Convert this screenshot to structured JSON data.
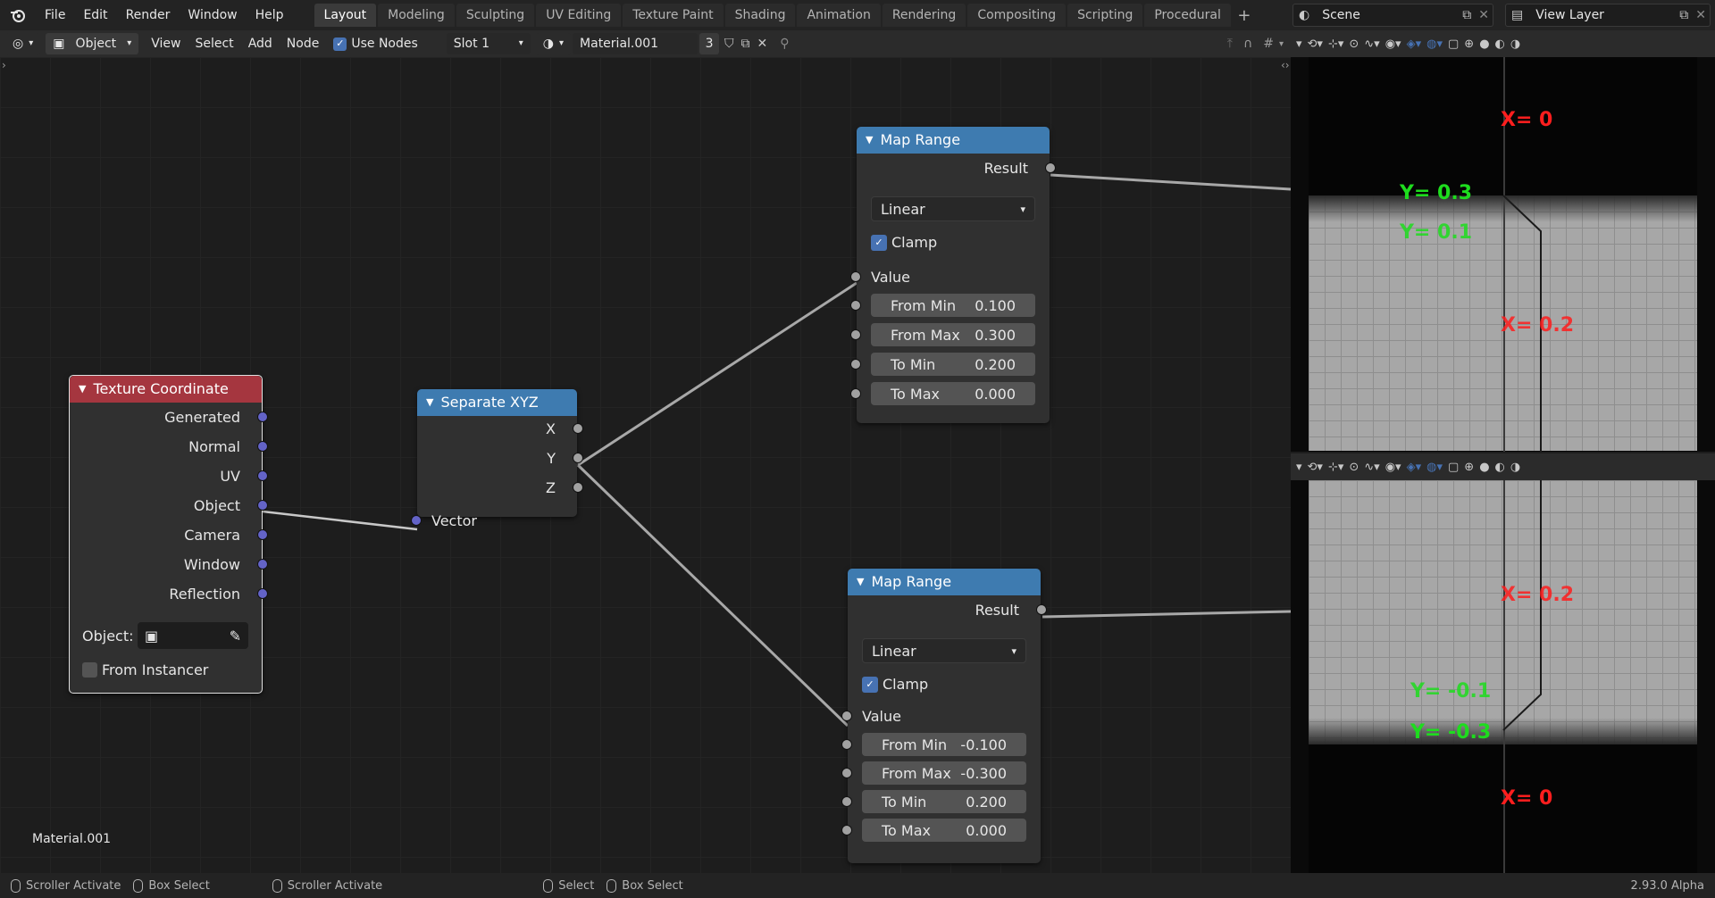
{
  "menu": [
    "File",
    "Edit",
    "Render",
    "Window",
    "Help"
  ],
  "workspaces": [
    "Layout",
    "Modeling",
    "Sculpting",
    "UV Editing",
    "Texture Paint",
    "Shading",
    "Animation",
    "Rendering",
    "Compositing",
    "Scripting",
    "Procedural"
  ],
  "active_workspace": "Layout",
  "scene": {
    "label": "Scene",
    "view_layer": "View Layer"
  },
  "header": {
    "mode": "Object",
    "view": "View",
    "select": "Select",
    "add": "Add",
    "node": "Node",
    "use_nodes": "Use Nodes",
    "slot": "Slot 1",
    "material": "Material.001",
    "users": "3"
  },
  "nodes": {
    "texcoord": {
      "title": "Texture Coordinate",
      "outputs": [
        "Generated",
        "Normal",
        "UV",
        "Object",
        "Camera",
        "Window",
        "Reflection"
      ],
      "object_label": "Object:",
      "from_instancer": "From Instancer"
    },
    "sepxyz": {
      "title": "Separate XYZ",
      "outputs": [
        "X",
        "Y",
        "Z"
      ],
      "input": "Vector"
    },
    "maprange1": {
      "title": "Map Range",
      "result": "Result",
      "interp": "Linear",
      "clamp": "Clamp",
      "value": "Value",
      "fields": [
        [
          "From Min",
          "0.100"
        ],
        [
          "From Max",
          "0.300"
        ],
        [
          "To Min",
          "0.200"
        ],
        [
          "To Max",
          "0.000"
        ]
      ]
    },
    "maprange2": {
      "title": "Map Range",
      "result": "Result",
      "interp": "Linear",
      "clamp": "Clamp",
      "value": "Value",
      "fields": [
        [
          "From Min",
          "-0.100"
        ],
        [
          "From Max",
          "-0.300"
        ],
        [
          "To Min",
          "0.200"
        ],
        [
          "To Max",
          "0.000"
        ]
      ]
    }
  },
  "material_label": "Material.001",
  "viewport_top": {
    "x0": "X= 0",
    "y03": "Y= 0.3",
    "y01": "Y= 0.1",
    "x02": "X= 0.2"
  },
  "viewport_bottom": {
    "x02": "X= 0.2",
    "ym01": "Y= -0.1",
    "ym03": "Y= -0.3",
    "x0": "X= 0"
  },
  "status": {
    "items": [
      "Scroller Activate",
      "Box Select",
      "Scroller Activate",
      "Select",
      "Box Select"
    ],
    "version": "2.93.0 Alpha"
  },
  "colors": {
    "accent": "#4772b3",
    "node_red": "#a5363f",
    "node_blue": "#3e7bb0"
  }
}
